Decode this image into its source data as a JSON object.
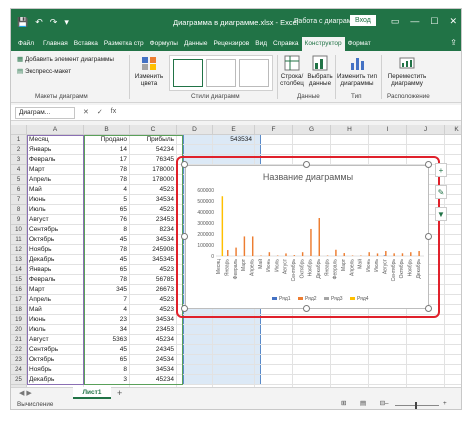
{
  "titlebar": {
    "qat": [
      "💾",
      "↶",
      "↷",
      "▾"
    ],
    "title": "Диаграмма в диаграмме.xlsx  -  Excel",
    "chart_tools": "Работа с диаграм...",
    "signin": "Вход",
    "win": [
      "▭",
      "—",
      "☐",
      "✕"
    ]
  },
  "tabs": [
    "Файл",
    "Главная",
    "Вставка",
    "Разметка стр",
    "Формулы",
    "Данные",
    "Рецензиров",
    "Вид",
    "Справка",
    "Конструктор",
    "Формат"
  ],
  "active_tab_index": 9,
  "ribbon": {
    "add_element": "Добавить элемент диаграммы",
    "express_layout": "Экспресс-макет",
    "layouts_label": "Макеты диаграмм",
    "change_colors": "Изменить цвета",
    "styles_label": "Стили диаграмм",
    "row_col": "Строка/столбец",
    "select_data": "Выбрать данные",
    "data_label": "Данные",
    "change_type": "Изменить тип диаграммы",
    "type_label": "Тип",
    "move_chart": "Переместить диаграмму",
    "location_label": "Расположение"
  },
  "formula_bar": {
    "namebox": "Диаграм...",
    "fx": [
      "✕",
      "✓",
      "fx"
    ]
  },
  "columns": [
    "A",
    "B",
    "C",
    "D",
    "E",
    "F",
    "G",
    "H",
    "I",
    "J",
    "K"
  ],
  "rows": [
    [
      "Месяц",
      "Продано",
      "Прибыль",
      "",
      "543534"
    ],
    [
      "Январь",
      "14",
      "54234",
      "",
      ""
    ],
    [
      "Февраль",
      "17",
      "76345",
      "",
      ""
    ],
    [
      "Март",
      "78",
      "178000",
      "",
      ""
    ],
    [
      "Апрель",
      "78",
      "178000",
      "",
      ""
    ],
    [
      "Май",
      "4",
      "4523",
      "",
      ""
    ],
    [
      "Июнь",
      "5",
      "34534",
      "",
      ""
    ],
    [
      "Июль",
      "65",
      "4523",
      "",
      ""
    ],
    [
      "Август",
      "76",
      "23453",
      "",
      ""
    ],
    [
      "Сентябрь",
      "8",
      "8234",
      "",
      ""
    ],
    [
      "Октябрь",
      "45",
      "34534",
      "",
      ""
    ],
    [
      "Ноябрь",
      "78",
      "245908",
      "",
      ""
    ],
    [
      "Декабрь",
      "45",
      "345345",
      "",
      ""
    ],
    [
      "Январь",
      "65",
      "4523",
      "",
      ""
    ],
    [
      "Февраль",
      "78",
      "56785",
      "",
      ""
    ],
    [
      "Март",
      "345",
      "26673",
      "",
      ""
    ],
    [
      "Апрель",
      "7",
      "4523",
      "",
      ""
    ],
    [
      "Май",
      "4",
      "4523",
      "",
      ""
    ],
    [
      "Июнь",
      "23",
      "34534",
      "",
      ""
    ],
    [
      "Июль",
      "34",
      "23453",
      "",
      ""
    ],
    [
      "Август",
      "5363",
      "45234",
      "",
      ""
    ],
    [
      "Сентябрь",
      "45",
      "24345",
      "",
      ""
    ],
    [
      "Октябрь",
      "65",
      "24534",
      "",
      ""
    ],
    [
      "Ноябрь",
      "8",
      "34534",
      "",
      ""
    ],
    [
      "Декабрь",
      "3",
      "45234",
      "",
      ""
    ]
  ],
  "chart_data": {
    "type": "bar",
    "title": "Название диаграммы",
    "ylim": [
      0,
      600000
    ],
    "yticks": [
      "600000",
      "500000",
      "400000",
      "300000",
      "200000",
      "100000",
      "0"
    ],
    "categories": [
      "Месяц",
      "Январь",
      "Февраль",
      "Март",
      "Апрель",
      "Май",
      "Июнь",
      "Июль",
      "Август",
      "Сентябрь",
      "Октябрь",
      "Ноябрь",
      "Декабрь",
      "Январь",
      "Февраль",
      "Март",
      "Апрель",
      "Май",
      "Июнь",
      "Июль",
      "Август",
      "Сентябрь",
      "Октябрь",
      "Ноябрь",
      "Декабрь"
    ],
    "series": [
      {
        "name": "Ряд1",
        "color": "#4472c4",
        "values": [
          0,
          14,
          17,
          78,
          78,
          4,
          5,
          65,
          76,
          8,
          45,
          78,
          45,
          65,
          78,
          345,
          7,
          4,
          23,
          34,
          5363,
          45,
          65,
          8,
          3
        ]
      },
      {
        "name": "Ряд2",
        "color": "#ed7d31",
        "values": [
          0,
          54234,
          76345,
          178000,
          178000,
          4523,
          34534,
          4523,
          23453,
          8234,
          34534,
          245908,
          345345,
          4523,
          56785,
          26673,
          4523,
          4523,
          34534,
          23453,
          45234,
          24345,
          24534,
          34534,
          45234
        ]
      },
      {
        "name": "Ряд3",
        "color": "#a5a5a5",
        "values": [
          0,
          0,
          0,
          0,
          0,
          0,
          0,
          0,
          0,
          0,
          0,
          0,
          0,
          0,
          0,
          0,
          0,
          0,
          0,
          0,
          0,
          0,
          0,
          0,
          0
        ]
      },
      {
        "name": "Ряд4",
        "color": "#ffc000",
        "values": [
          543534,
          0,
          0,
          0,
          0,
          0,
          0,
          0,
          0,
          0,
          0,
          0,
          0,
          0,
          0,
          0,
          0,
          0,
          0,
          0,
          0,
          0,
          0,
          0,
          0
        ]
      }
    ],
    "legend_position": "bottom",
    "grid": false
  },
  "sheet": {
    "tab": "Лист1",
    "add": "+"
  },
  "status": {
    "ready": "Вычисление",
    "icons": [
      "⊞",
      "▤",
      "⊟"
    ],
    "zoom_controls": [
      "–",
      "+"
    ]
  },
  "colors": {
    "accent": "#217346",
    "highlight": "#e0212b",
    "selection": "#dce9f6"
  }
}
